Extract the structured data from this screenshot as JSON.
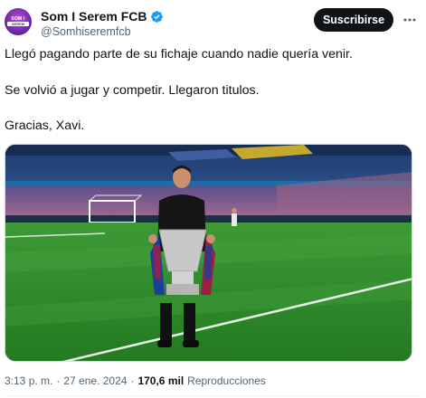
{
  "header": {
    "display_name": "Som I Serem FCB",
    "handle": "@Somhiseremfcb",
    "subscribe_label": "Suscribirse",
    "avatar_text_top": "SOM I",
    "avatar_text_band": "SEREM",
    "verified_color": "#1d9bf0"
  },
  "tweet": {
    "line1": "Llegó pagando parte de su fichaje cuando nadie quería venir.",
    "line2": "Se volvió a jugar y competir. Llegaron titulos.",
    "line3": "Gracias, Xavi."
  },
  "footer": {
    "time": "3:13 p. m.",
    "sep1": "·",
    "date": "27 ene. 2024",
    "sep2": "·",
    "views_count": "170,6 mil",
    "views_label": "Reproducciones"
  },
  "colors": {
    "text": "#0f1419",
    "secondary": "#536471",
    "button_bg": "#0f1419",
    "pitch": "#2f8a2c",
    "seats": "#8a5a8c"
  }
}
